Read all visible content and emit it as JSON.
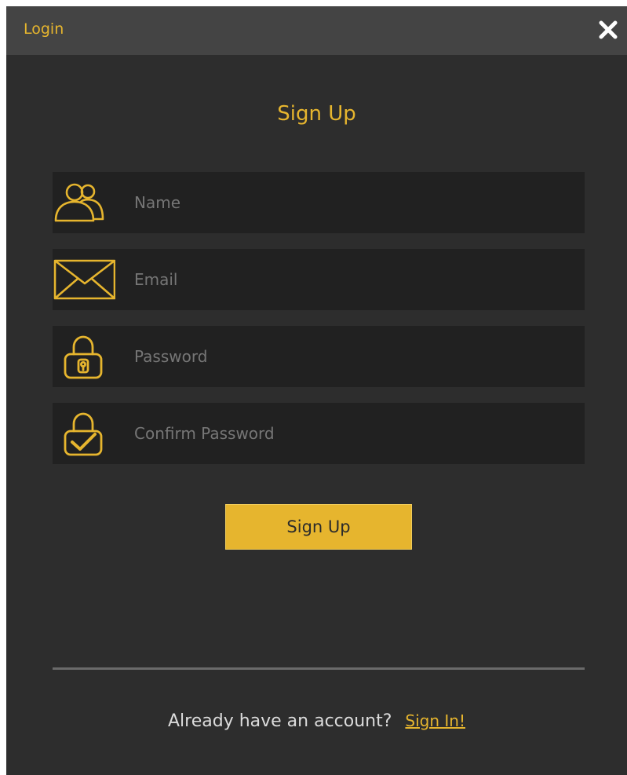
{
  "window": {
    "title": "Login",
    "close_icon": "close-icon"
  },
  "form": {
    "heading": "Sign Up",
    "fields": [
      {
        "icon": "users-icon",
        "placeholder": "Name",
        "value": ""
      },
      {
        "icon": "envelope-icon",
        "placeholder": "Email",
        "value": ""
      },
      {
        "icon": "lock-icon",
        "placeholder": "Password",
        "value": ""
      },
      {
        "icon": "lock-check-icon",
        "placeholder": "Confirm Password",
        "value": ""
      }
    ],
    "submit_label": "Sign Up"
  },
  "footer": {
    "prompt": "Already have an account?",
    "link_label": "Sign In!"
  },
  "colors": {
    "accent": "#e6b52e",
    "background": "#2d2d2d",
    "titlebar": "#444444",
    "field_background": "#212121"
  }
}
